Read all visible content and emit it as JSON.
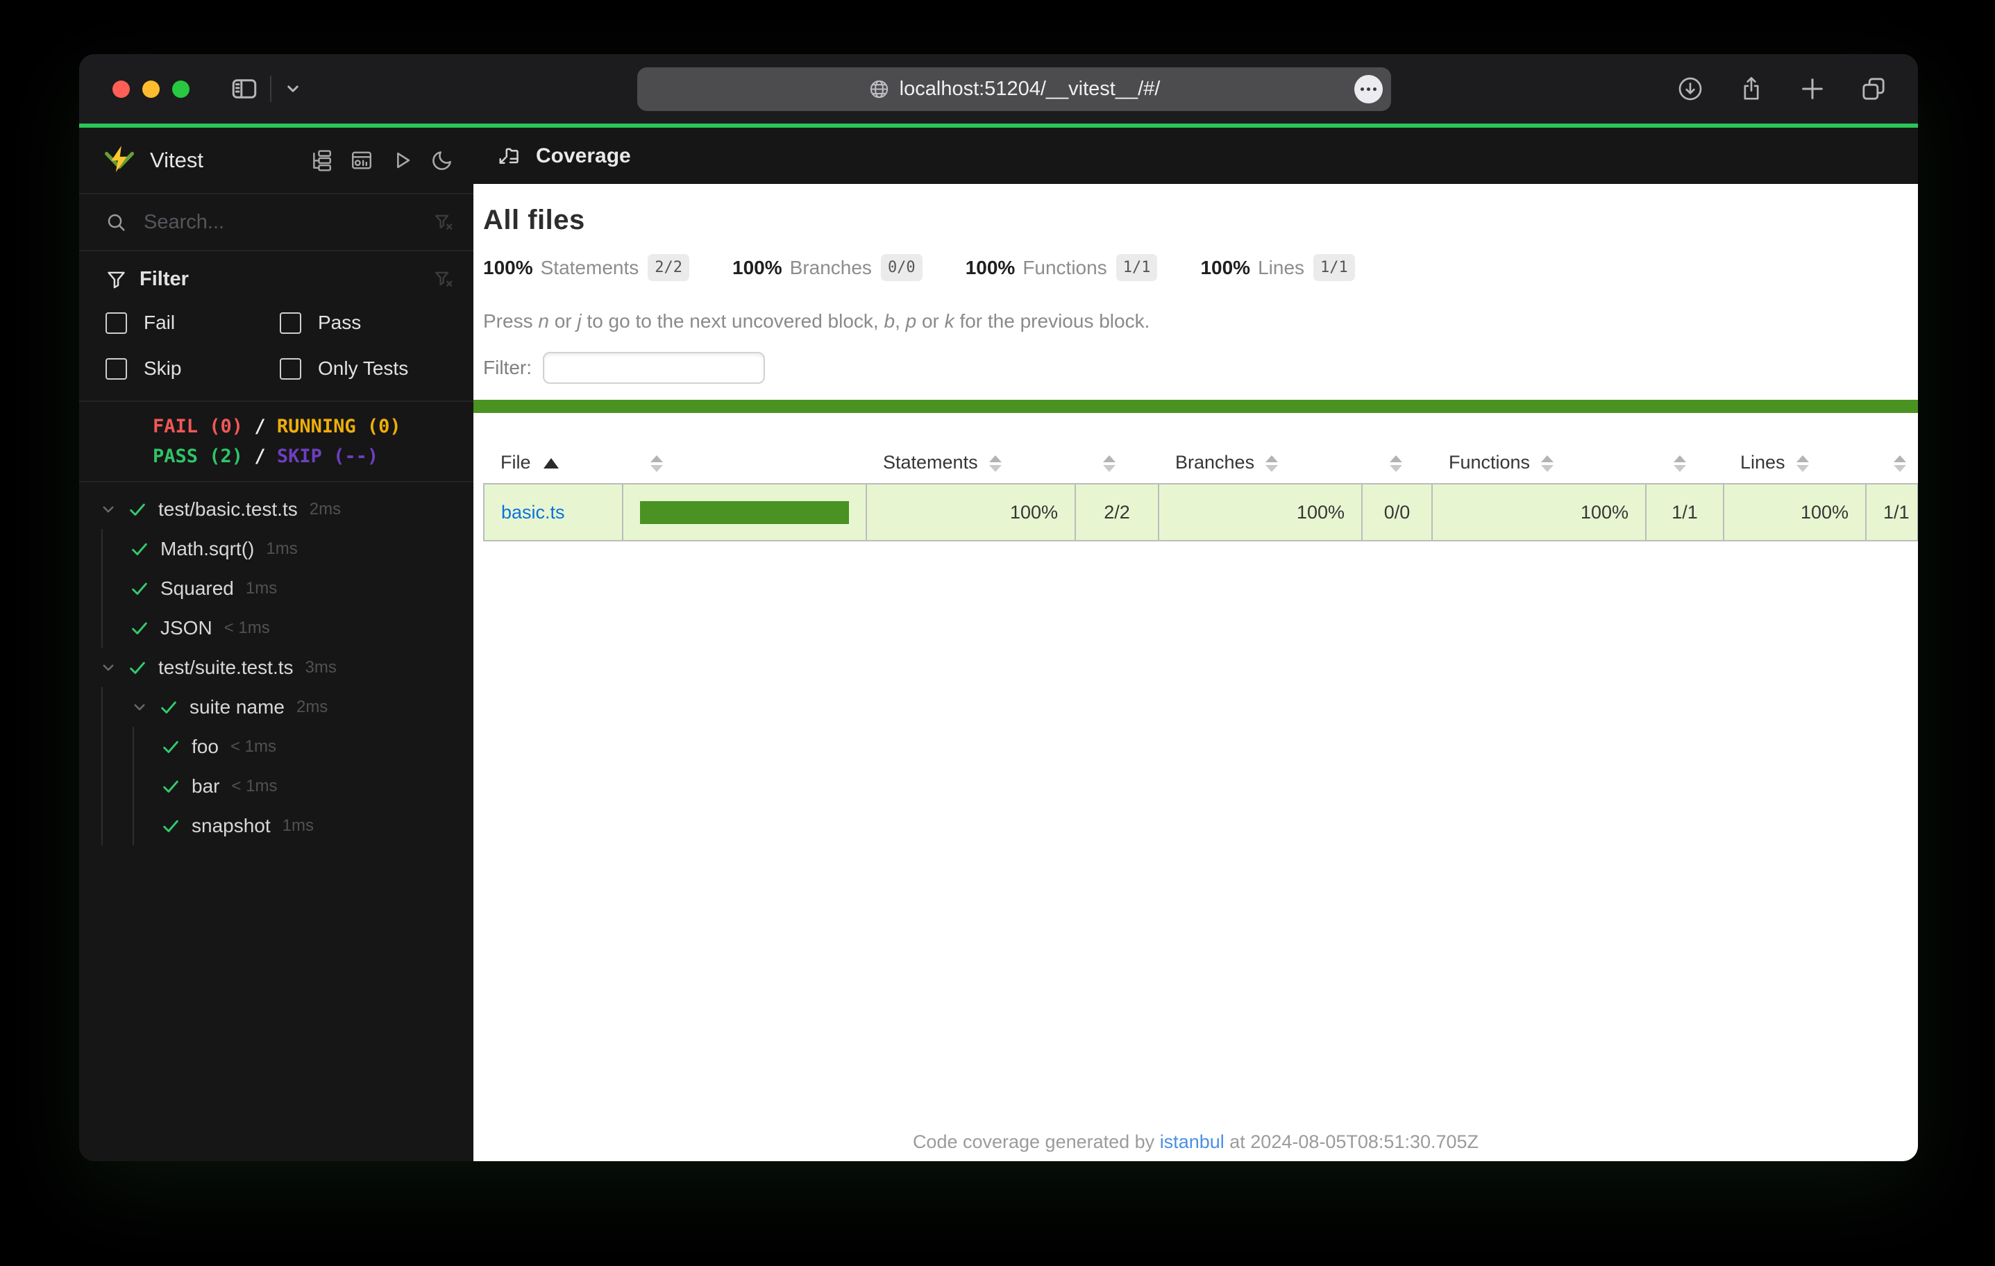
{
  "browser": {
    "url": "localhost:51204/__vitest__/#/",
    "traffic_lights": {
      "close": "#ff5f57",
      "minimize": "#febc2e",
      "zoom": "#28c840"
    },
    "toolbar_icons": [
      "sidebar-toggle-icon",
      "chevron-down-icon",
      "globe-icon",
      "more-ellipsis-icon",
      "download-icon",
      "share-icon",
      "new-tab-plus-icon",
      "tab-overview-icon"
    ]
  },
  "colors": {
    "accent_line": "#2bc558",
    "coverage_high_green": "#4a9222",
    "coverage_row_bg": "#e7f6d1",
    "fail_red": "#f25757",
    "running_amber": "#eeae09",
    "pass_green": "#30c468",
    "skip_purple": "#6d3fc0",
    "link_blue": "#0b72dd",
    "footer_link_blue": "#4a90e2",
    "sidebar_bg": "#161616",
    "content_bg": "#ffffff"
  },
  "sidebar": {
    "app_title": "Vitest",
    "header_icons": [
      "tree-view-icon",
      "dashboard-icon",
      "run-all-icon",
      "dark-mode-moon-icon"
    ],
    "search_placeholder": "Search...",
    "filter": {
      "title": "Filter",
      "options": [
        {
          "label": "Fail",
          "checked": false
        },
        {
          "label": "Pass",
          "checked": false
        },
        {
          "label": "Skip",
          "checked": false
        },
        {
          "label": "Only Tests",
          "checked": false
        }
      ]
    },
    "status": {
      "fail": "FAIL (0)",
      "running": "RUNNING (0)",
      "pass": "PASS (2)",
      "skip": "SKIP (--)",
      "separator": "/"
    },
    "tree": [
      {
        "label": "test/basic.test.ts",
        "duration": "2ms",
        "level": 0,
        "chevron": true,
        "state": "pass"
      },
      {
        "label": "Math.sqrt()",
        "duration": "1ms",
        "level": 1,
        "chevron": false,
        "state": "pass"
      },
      {
        "label": "Squared",
        "duration": "1ms",
        "level": 1,
        "chevron": false,
        "state": "pass"
      },
      {
        "label": "JSON",
        "duration": "< 1ms",
        "level": 1,
        "chevron": false,
        "state": "pass"
      },
      {
        "label": "test/suite.test.ts",
        "duration": "3ms",
        "level": 0,
        "chevron": true,
        "state": "pass"
      },
      {
        "label": "suite name",
        "duration": "2ms",
        "level": 1,
        "chevron": true,
        "state": "pass"
      },
      {
        "label": "foo",
        "duration": "< 1ms",
        "level": 2,
        "chevron": false,
        "state": "pass"
      },
      {
        "label": "bar",
        "duration": "< 1ms",
        "level": 2,
        "chevron": false,
        "state": "pass"
      },
      {
        "label": "snapshot",
        "duration": "1ms",
        "level": 2,
        "chevron": false,
        "state": "pass"
      }
    ]
  },
  "main": {
    "header_title": "Coverage",
    "page_title": "All files",
    "metrics": [
      {
        "pct": "100%",
        "label": "Statements",
        "fraction": "2/2"
      },
      {
        "pct": "100%",
        "label": "Branches",
        "fraction": "0/0"
      },
      {
        "pct": "100%",
        "label": "Functions",
        "fraction": "1/1"
      },
      {
        "pct": "100%",
        "label": "Lines",
        "fraction": "1/1"
      }
    ],
    "hint_parts": [
      {
        "t": "Press "
      },
      {
        "t": "n",
        "i": true
      },
      {
        "t": " or "
      },
      {
        "t": "j",
        "i": true
      },
      {
        "t": " to go to the next uncovered block, "
      },
      {
        "t": "b",
        "i": true
      },
      {
        "t": ", "
      },
      {
        "t": "p",
        "i": true
      },
      {
        "t": " or "
      },
      {
        "t": "k",
        "i": true
      },
      {
        "t": " for the previous block."
      }
    ],
    "filter_label": "Filter:",
    "filter_value": "",
    "table": {
      "headers": {
        "file": "File",
        "statements": "Statements",
        "branches": "Branches",
        "functions": "Functions",
        "lines": "Lines"
      },
      "sort": {
        "column": "file",
        "direction": "asc"
      },
      "rows": [
        {
          "file": "basic.ts",
          "bar_pct": 100,
          "statements_pct": "100%",
          "statements": "2/2",
          "branches_pct": "100%",
          "branches": "0/0",
          "functions_pct": "100%",
          "functions": "1/1",
          "lines_pct": "100%",
          "lines": "1/1"
        }
      ]
    },
    "footer": {
      "prefix": "Code coverage generated by ",
      "link": "istanbul",
      "suffix": " at 2024-08-05T08:51:30.705Z"
    }
  }
}
